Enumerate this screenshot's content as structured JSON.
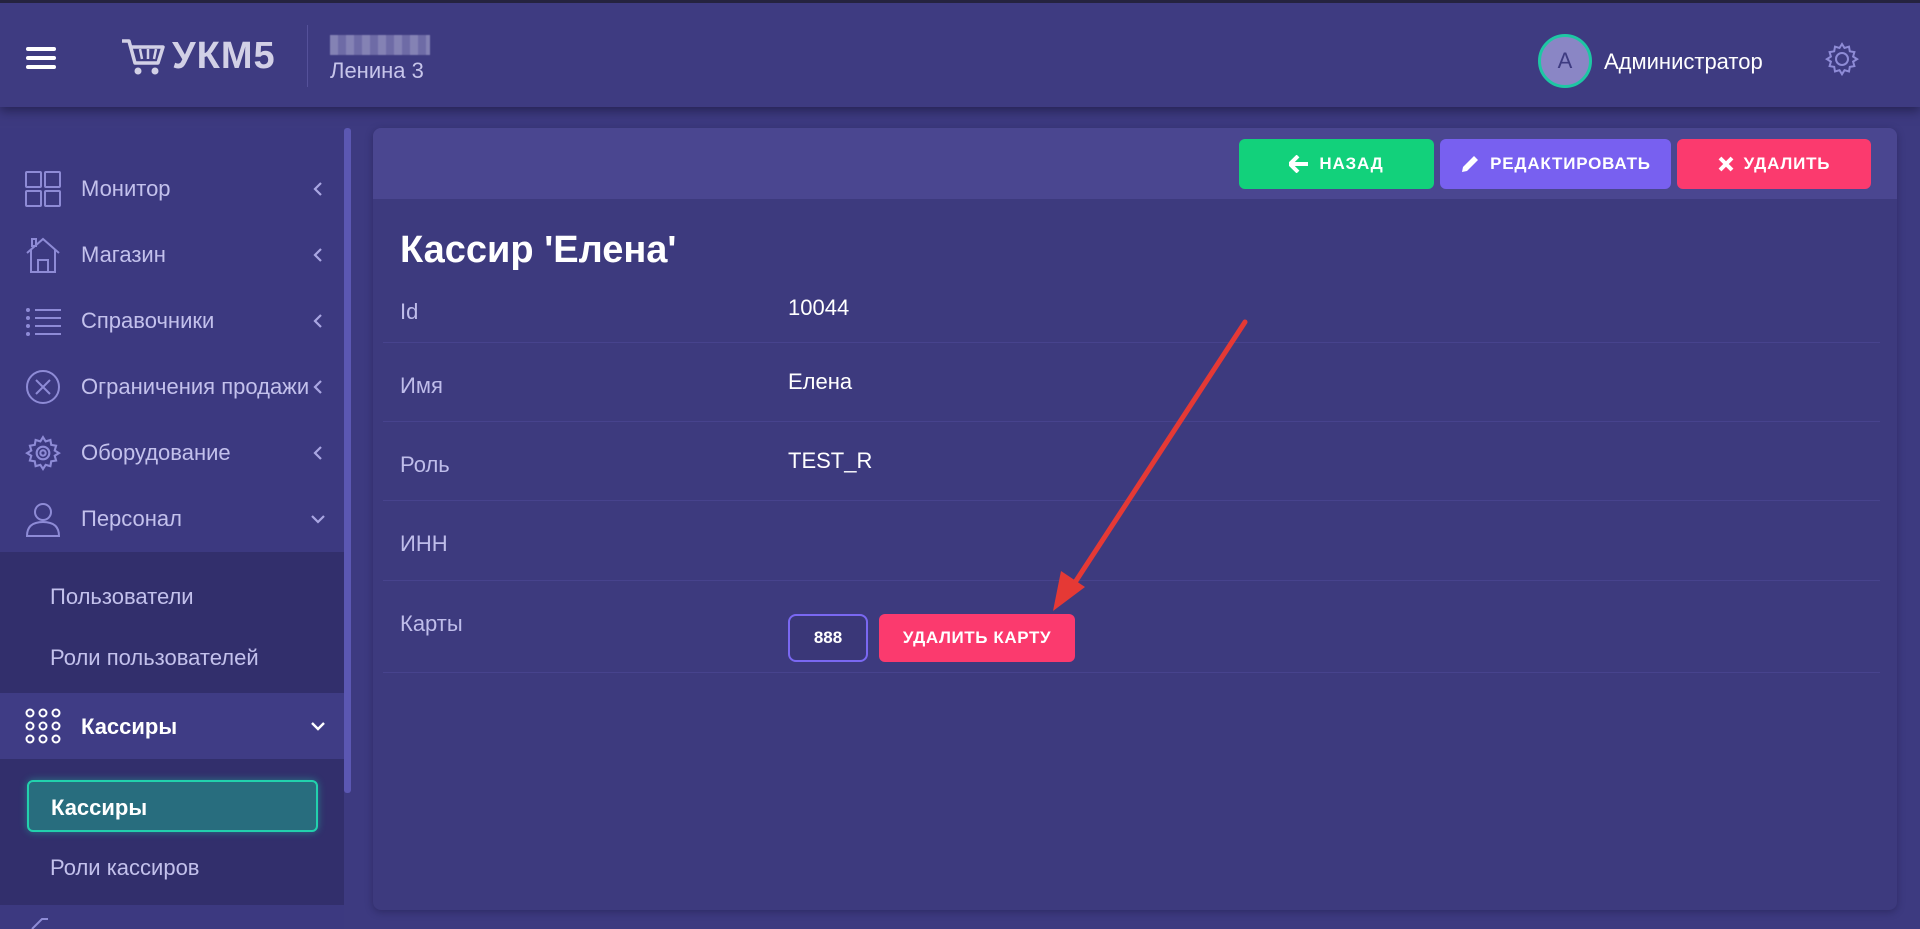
{
  "header": {
    "logo_text": "УКМ5",
    "store_name": "Ленина 3",
    "avatar_letter": "A",
    "user_name": "Администратор"
  },
  "sidebar": {
    "items": [
      {
        "label": "Монитор",
        "icon": "monitor-grid-icon"
      },
      {
        "label": "Магазин",
        "icon": "store-house-icon"
      },
      {
        "label": "Справочники",
        "icon": "list-icon"
      },
      {
        "label": "Ограничения продажи",
        "icon": "circle-x-icon"
      },
      {
        "label": "Оборудование",
        "icon": "gear-icon"
      },
      {
        "label": "Персонал",
        "icon": "user-icon"
      }
    ],
    "personnel_sub": [
      "Пользователи",
      "Роли пользователей"
    ],
    "cashiers_label": "Кассиры",
    "cashiers_sub": [
      "Кассиры",
      "Роли кассиров"
    ]
  },
  "toolbar": {
    "back_label": "НАЗАД",
    "edit_label": "РЕДАКТИРОВАТЬ",
    "delete_label": "УДАЛИТЬ"
  },
  "page": {
    "title": "Кассир 'Елена'",
    "fields": [
      {
        "label": "Id",
        "value": "10044"
      },
      {
        "label": "Имя",
        "value": "Елена"
      },
      {
        "label": "Роль",
        "value": "TEST_R"
      },
      {
        "label": "ИНН",
        "value": ""
      },
      {
        "label": "Карты",
        "value": ""
      }
    ],
    "card_number": "888",
    "delete_card_label": "УДАЛИТЬ КАРТУ"
  },
  "colors": {
    "background": "#3d3a80",
    "accent_green": "#12d17b",
    "accent_purple": "#7860f0",
    "accent_red": "#fb3a6e",
    "active_teal": "#22d1ad",
    "annotation_arrow": "#e53935"
  }
}
